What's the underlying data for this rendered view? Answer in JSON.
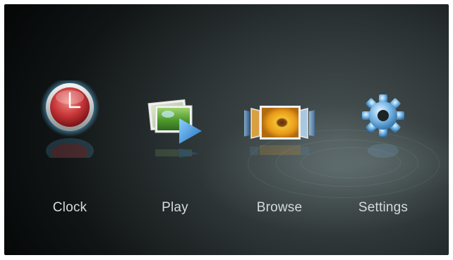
{
  "menu": {
    "items": [
      {
        "id": "clock",
        "label": "Clock",
        "icon": "clock-icon"
      },
      {
        "id": "play",
        "label": "Play",
        "icon": "play-slideshow-icon"
      },
      {
        "id": "browse",
        "label": "Browse",
        "icon": "browse-photos-icon"
      },
      {
        "id": "settings",
        "label": "Settings",
        "icon": "gear-icon"
      }
    ]
  },
  "colors": {
    "background_center": "#4b5556",
    "background_edge": "#060808",
    "label_text": "#d6dbdb",
    "clock_face": "#c9383a",
    "clock_glow": "#5fc9ff",
    "play_arrow": "#2f8fe0",
    "gear": "#7ab8e6"
  }
}
